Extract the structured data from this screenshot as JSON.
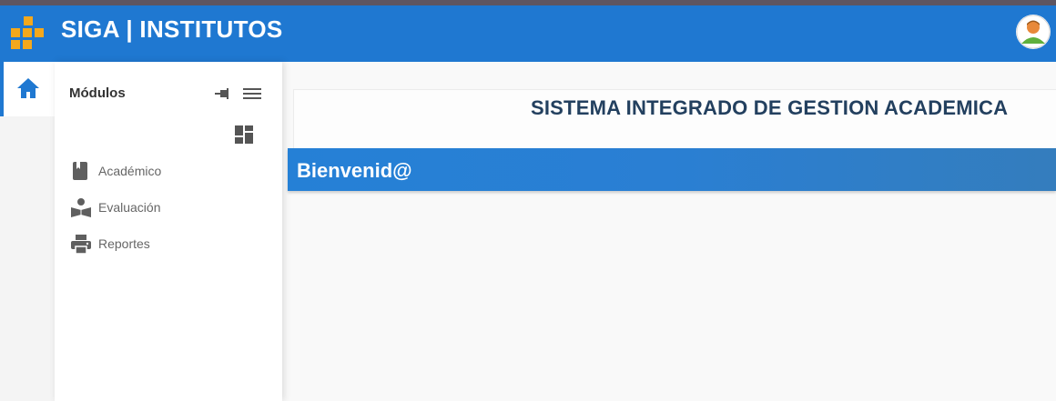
{
  "header": {
    "title": "SIGA | INSTITUTOS",
    "logo_icon": "siga-logo-icon",
    "avatar_icon": "user-avatar-icon",
    "background": "#1f78d1"
  },
  "rail": {
    "home_icon": "home-icon"
  },
  "sidebar": {
    "title": "Módulos",
    "items": [
      {
        "label": "Académico",
        "icon": "book-icon"
      },
      {
        "label": "Evaluación",
        "icon": "reader-icon"
      },
      {
        "label": "Reportes",
        "icon": "printer-icon"
      }
    ]
  },
  "main": {
    "system_title": "SISTEMA INTEGRADO DE GESTION ACADEMICA",
    "welcome": "Bienvenid@",
    "accent": "#23405f"
  }
}
